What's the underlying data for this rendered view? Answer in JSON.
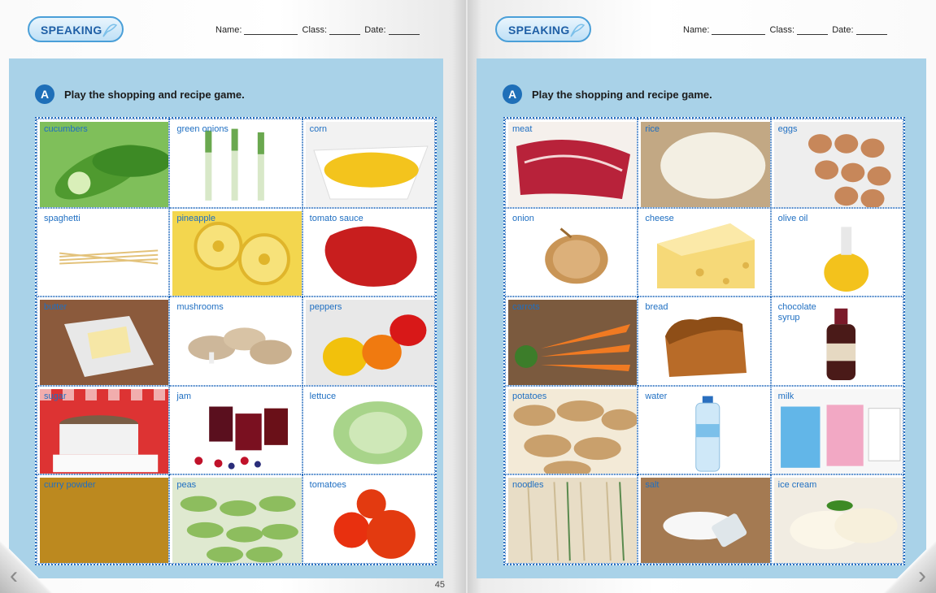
{
  "left_page": {
    "badge": "SPEAKING",
    "fields": {
      "name": "Name:",
      "class": "Class:",
      "date": "Date:"
    },
    "instruction_letter": "A",
    "instruction": "Play the shopping and recipe game.",
    "page_number": "45",
    "items": [
      {
        "label": "cucumbers",
        "image": "cucumbers"
      },
      {
        "label": "green onions",
        "image": "green-onions"
      },
      {
        "label": "corn",
        "image": "corn"
      },
      {
        "label": "spaghetti",
        "image": "spaghetti"
      },
      {
        "label": "pineapple",
        "image": "pineapple"
      },
      {
        "label": "tomato sauce",
        "image": "tomato-sauce"
      },
      {
        "label": "butter",
        "image": "butter"
      },
      {
        "label": "mushrooms",
        "image": "mushrooms"
      },
      {
        "label": "peppers",
        "image": "peppers"
      },
      {
        "label": "sugar",
        "image": "sugar"
      },
      {
        "label": "jam",
        "image": "jam"
      },
      {
        "label": "lettuce",
        "image": "lettuce"
      },
      {
        "label": "curry powder",
        "image": "curry-powder"
      },
      {
        "label": "peas",
        "image": "peas"
      },
      {
        "label": "tomatoes",
        "image": "tomatoes"
      }
    ]
  },
  "right_page": {
    "badge": "SPEAKING",
    "fields": {
      "name": "Name:",
      "class": "Class:",
      "date": "Date:"
    },
    "instruction_letter": "A",
    "instruction": "Play the shopping and recipe game.",
    "items": [
      {
        "label": "meat",
        "image": "meat"
      },
      {
        "label": "rice",
        "image": "rice"
      },
      {
        "label": "eggs",
        "image": "eggs"
      },
      {
        "label": "onion",
        "image": "onion"
      },
      {
        "label": "cheese",
        "image": "cheese"
      },
      {
        "label": "olive oil",
        "image": "olive-oil"
      },
      {
        "label": "carrots",
        "image": "carrots"
      },
      {
        "label": "bread",
        "image": "bread"
      },
      {
        "label": "chocolate syrup",
        "image": "chocolate-syrup"
      },
      {
        "label": "potatoes",
        "image": "potatoes"
      },
      {
        "label": "water",
        "image": "water-bottle"
      },
      {
        "label": "milk",
        "image": "milk-cartons"
      },
      {
        "label": "noodles",
        "image": "noodles"
      },
      {
        "label": "salt",
        "image": "salt"
      },
      {
        "label": "ice cream",
        "image": "ice-cream"
      }
    ]
  },
  "nav": {
    "prev_icon": "chevron-left-icon",
    "next_icon": "chevron-right-icon",
    "prev_glyph": "‹",
    "next_glyph": "›"
  },
  "colors": {
    "panel": "#a9d2e8",
    "label": "#1f6fc2",
    "badge_text": "#1f5fa6",
    "accent": "#1f6fb8"
  }
}
